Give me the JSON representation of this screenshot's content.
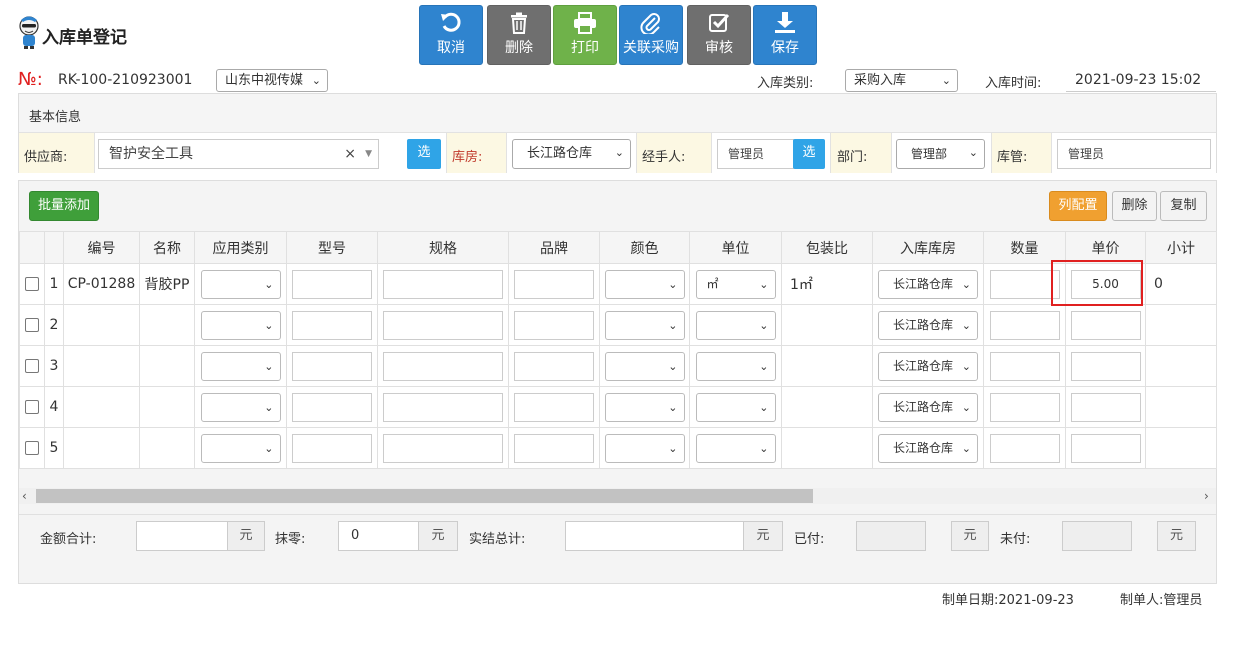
{
  "header": {
    "title": "入库单登记",
    "toolbar": [
      {
        "id": "cancel",
        "label": "取消",
        "icon": "undo-icon",
        "color": "#2f84cf"
      },
      {
        "id": "delete",
        "label": "删除",
        "icon": "trash-icon",
        "color": "#6f6f6f"
      },
      {
        "id": "print",
        "label": "打印",
        "icon": "printer-icon",
        "color": "#6fb24a"
      },
      {
        "id": "link-purchase",
        "label": "关联采购",
        "icon": "paperclip-icon",
        "color": "#2f84cf"
      },
      {
        "id": "audit",
        "label": "审核",
        "icon": "check-square-icon",
        "color": "#6f6f6f"
      },
      {
        "id": "save",
        "label": "保存",
        "icon": "download-icon",
        "color": "#2f84cf"
      }
    ]
  },
  "order": {
    "no_label": "№:",
    "no_value": "RK-100-210923001",
    "company": "山东中视传媒",
    "type_label": "入库类别:",
    "type_value": "采购入库",
    "time_label": "入库时间:",
    "time_value": "2021-09-23 15:02"
  },
  "basic_info": {
    "title": "基本信息",
    "supplier_label": "供应商:",
    "supplier_value": "智护安全工具",
    "select_label": "选",
    "clear_mark": "×",
    "warehouse_label": "库房:",
    "warehouse_value": "长江路仓库",
    "handler_label": "经手人:",
    "handler_value": "管理员",
    "dept_label": "部门:",
    "dept_value": "管理部",
    "keeper_label": "库管:",
    "keeper_value": "管理员"
  },
  "grid": {
    "batch_add": "批量添加",
    "col_config": "列配置",
    "delete": "删除",
    "copy": "复制",
    "columns": [
      "编号",
      "名称",
      "应用类别",
      "型号",
      "规格",
      "品牌",
      "颜色",
      "单位",
      "包装比",
      "入库库房",
      "数量",
      "单价",
      "小计"
    ],
    "rows": [
      {
        "num": "1",
        "code": "CP-01288",
        "name": "背胶PP",
        "unit": "㎡",
        "pack": "1㎡",
        "warehouse": "长江路仓库",
        "price": "5.00",
        "subtotal": "0"
      },
      {
        "num": "2",
        "code": "",
        "name": "",
        "unit": "",
        "pack": "",
        "warehouse": "长江路仓库",
        "price": "",
        "subtotal": ""
      },
      {
        "num": "3",
        "code": "",
        "name": "",
        "unit": "",
        "pack": "",
        "warehouse": "长江路仓库",
        "price": "",
        "subtotal": ""
      },
      {
        "num": "4",
        "code": "",
        "name": "",
        "unit": "",
        "pack": "",
        "warehouse": "长江路仓库",
        "price": "",
        "subtotal": ""
      },
      {
        "num": "5",
        "code": "",
        "name": "",
        "unit": "",
        "pack": "",
        "warehouse": "长江路仓库",
        "price": "",
        "subtotal": ""
      }
    ]
  },
  "totals": {
    "amount_label": "金额合计:",
    "amount_value": "",
    "round_label": "抹零:",
    "round_value": "0",
    "actual_label": "实结总计:",
    "actual_value": "",
    "paid_label": "已付:",
    "paid_value": "",
    "unpaid_label": "未付:",
    "unpaid_value": "",
    "unit": "元"
  },
  "footer": {
    "date_label": "制单日期:",
    "date_value": "2021-09-23",
    "maker_label": "制单人:",
    "maker_value": "管理员"
  },
  "colors": {
    "highlight": "#e02020",
    "primary": "#2f84cf",
    "success": "#3f9f3a",
    "warning": "#f0a030"
  }
}
